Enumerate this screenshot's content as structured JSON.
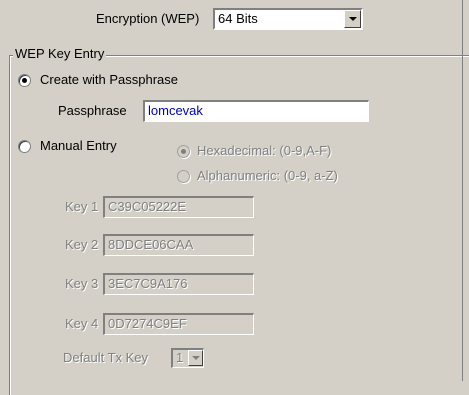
{
  "encryption": {
    "label": "Encryption (WEP)",
    "selected": "64 Bits"
  },
  "group": {
    "title": "WEP Key Entry"
  },
  "passphrase_mode": {
    "label": "Create with Passphrase",
    "selected": true,
    "field_label": "Passphrase",
    "value": "lomcevak"
  },
  "manual_mode": {
    "label": "Manual Entry",
    "selected": false,
    "hex_label": "Hexadecimal: (0-9,A-F)",
    "alnum_label": "Alphanumeric: (0-9, a-Z)"
  },
  "keys": [
    {
      "label": "Key 1",
      "value": "C39C05222E"
    },
    {
      "label": "Key 2",
      "value": "8DDCE06CAA"
    },
    {
      "label": "Key 3",
      "value": "3EC7C9A176"
    },
    {
      "label": "Key 4",
      "value": "0D7274C9EF"
    }
  ],
  "default_tx": {
    "label": "Default Tx Key",
    "value": "1"
  }
}
